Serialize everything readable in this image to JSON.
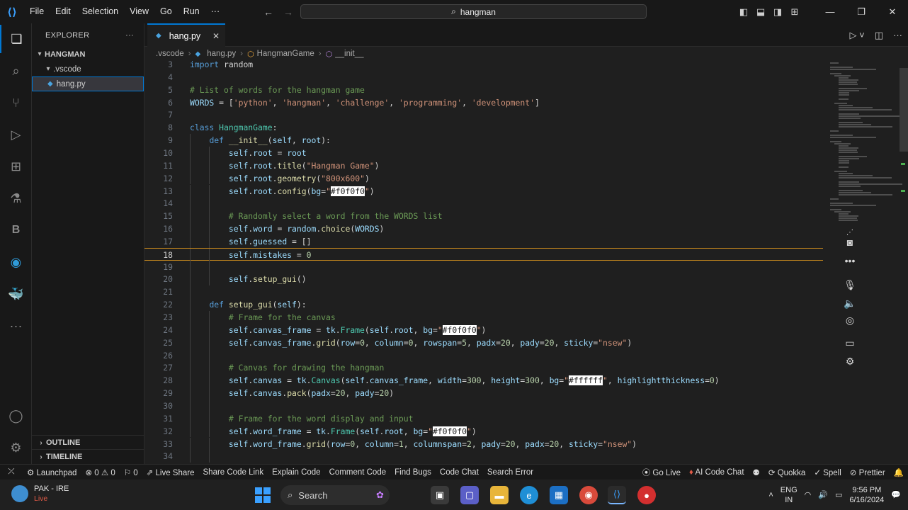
{
  "titlebar": {
    "menu": [
      "File",
      "Edit",
      "Selection",
      "View",
      "Go",
      "Run",
      "···"
    ],
    "search_text": "hangman"
  },
  "sidebar": {
    "title": "EXPLORER",
    "more": "···",
    "root": "HANGMAN",
    "folder": ".vscode",
    "file": "hang.py",
    "outline": "OUTLINE",
    "timeline": "TIMELINE"
  },
  "tab": {
    "label": "hang.py"
  },
  "breadcrumb": [
    ".vscode",
    "hang.py",
    "HangmanGame",
    "__init__"
  ],
  "code": {
    "active_line": 18,
    "lines": [
      {
        "n": 3,
        "indent": 0,
        "tokens": [
          [
            "kw",
            "import"
          ],
          [
            "plain",
            " random"
          ]
        ]
      },
      {
        "n": 4,
        "indent": 0,
        "tokens": []
      },
      {
        "n": 5,
        "indent": 0,
        "tokens": [
          [
            "cm",
            "# List of words for the hangman game"
          ]
        ]
      },
      {
        "n": 6,
        "indent": 0,
        "tokens": [
          [
            "sf",
            "WORDS"
          ],
          [
            "plain",
            " = ["
          ],
          [
            "str",
            "'python'"
          ],
          [
            "plain",
            ", "
          ],
          [
            "str",
            "'hangman'"
          ],
          [
            "plain",
            ", "
          ],
          [
            "str",
            "'challenge'"
          ],
          [
            "plain",
            ", "
          ],
          [
            "str",
            "'programming'"
          ],
          [
            "plain",
            ", "
          ],
          [
            "str",
            "'development'"
          ],
          [
            "plain",
            "]"
          ]
        ]
      },
      {
        "n": 7,
        "indent": 0,
        "tokens": []
      },
      {
        "n": 8,
        "indent": 0,
        "tokens": [
          [
            "kw",
            "class "
          ],
          [
            "cls",
            "HangmanGame"
          ],
          [
            "plain",
            ":"
          ]
        ]
      },
      {
        "n": 9,
        "indent": 1,
        "tokens": [
          [
            "kw",
            "def "
          ],
          [
            "fn",
            "__init__"
          ],
          [
            "plain",
            "("
          ],
          [
            "sf",
            "self"
          ],
          [
            "plain",
            ", "
          ],
          [
            "sf",
            "root"
          ],
          [
            "plain",
            "):"
          ]
        ]
      },
      {
        "n": 10,
        "indent": 2,
        "tokens": [
          [
            "sf",
            "self"
          ],
          [
            "plain",
            "."
          ],
          [
            "sf",
            "root"
          ],
          [
            "plain",
            " = "
          ],
          [
            "sf",
            "root"
          ]
        ]
      },
      {
        "n": 11,
        "indent": 2,
        "tokens": [
          [
            "sf",
            "self"
          ],
          [
            "plain",
            "."
          ],
          [
            "sf",
            "root"
          ],
          [
            "plain",
            "."
          ],
          [
            "fn",
            "title"
          ],
          [
            "plain",
            "("
          ],
          [
            "str",
            "\"Hangman Game\""
          ],
          [
            "plain",
            ")"
          ]
        ]
      },
      {
        "n": 12,
        "indent": 2,
        "tokens": [
          [
            "sf",
            "self"
          ],
          [
            "plain",
            "."
          ],
          [
            "sf",
            "root"
          ],
          [
            "plain",
            "."
          ],
          [
            "fn",
            "geometry"
          ],
          [
            "plain",
            "("
          ],
          [
            "str",
            "\"800x600\""
          ],
          [
            "plain",
            ")"
          ]
        ]
      },
      {
        "n": 13,
        "indent": 2,
        "tokens": [
          [
            "sf",
            "self"
          ],
          [
            "plain",
            "."
          ],
          [
            "sf",
            "root"
          ],
          [
            "plain",
            "."
          ],
          [
            "fn",
            "config"
          ],
          [
            "plain",
            "("
          ],
          [
            "sf",
            "bg"
          ],
          [
            "plain",
            "="
          ],
          [
            "str",
            "\""
          ],
          [
            "hl",
            "#f0f0f0"
          ],
          [
            "str",
            "\""
          ],
          [
            "plain",
            ")"
          ]
        ]
      },
      {
        "n": 14,
        "indent": 2,
        "tokens": []
      },
      {
        "n": 15,
        "indent": 2,
        "tokens": [
          [
            "cm",
            "# Randomly select a word from the WORDS list"
          ]
        ]
      },
      {
        "n": 16,
        "indent": 2,
        "tokens": [
          [
            "sf",
            "self"
          ],
          [
            "plain",
            "."
          ],
          [
            "sf",
            "word"
          ],
          [
            "plain",
            " = "
          ],
          [
            "sf",
            "random"
          ],
          [
            "plain",
            "."
          ],
          [
            "fn",
            "choice"
          ],
          [
            "plain",
            "("
          ],
          [
            "sf",
            "WORDS"
          ],
          [
            "plain",
            ")"
          ]
        ]
      },
      {
        "n": 17,
        "indent": 2,
        "tokens": [
          [
            "sf",
            "self"
          ],
          [
            "plain",
            "."
          ],
          [
            "sf",
            "guessed"
          ],
          [
            "plain",
            " = []"
          ]
        ]
      },
      {
        "n": 18,
        "indent": 2,
        "tokens": [
          [
            "sf",
            "self"
          ],
          [
            "plain",
            "."
          ],
          [
            "sf",
            "mistakes"
          ],
          [
            "plain",
            " = "
          ],
          [
            "num",
            "0"
          ]
        ]
      },
      {
        "n": 19,
        "indent": 2,
        "tokens": []
      },
      {
        "n": 20,
        "indent": 2,
        "tokens": [
          [
            "sf",
            "self"
          ],
          [
            "plain",
            "."
          ],
          [
            "fn",
            "setup_gui"
          ],
          [
            "plain",
            "()"
          ]
        ]
      },
      {
        "n": 21,
        "indent": 1,
        "tokens": []
      },
      {
        "n": 22,
        "indent": 1,
        "tokens": [
          [
            "kw",
            "def "
          ],
          [
            "fn",
            "setup_gui"
          ],
          [
            "plain",
            "("
          ],
          [
            "sf",
            "self"
          ],
          [
            "plain",
            "):"
          ]
        ]
      },
      {
        "n": 23,
        "indent": 2,
        "tokens": [
          [
            "cm",
            "# Frame for the canvas"
          ]
        ]
      },
      {
        "n": 24,
        "indent": 2,
        "tokens": [
          [
            "sf",
            "self"
          ],
          [
            "plain",
            "."
          ],
          [
            "sf",
            "canvas_frame"
          ],
          [
            "plain",
            " = "
          ],
          [
            "sf",
            "tk"
          ],
          [
            "plain",
            "."
          ],
          [
            "cls",
            "Frame"
          ],
          [
            "plain",
            "("
          ],
          [
            "sf",
            "self"
          ],
          [
            "plain",
            "."
          ],
          [
            "sf",
            "root"
          ],
          [
            "plain",
            ", "
          ],
          [
            "sf",
            "bg"
          ],
          [
            "plain",
            "="
          ],
          [
            "str",
            "\""
          ],
          [
            "hl",
            "#f0f0f0"
          ],
          [
            "str",
            "\""
          ],
          [
            "plain",
            ")"
          ]
        ]
      },
      {
        "n": 25,
        "indent": 2,
        "tokens": [
          [
            "sf",
            "self"
          ],
          [
            "plain",
            "."
          ],
          [
            "sf",
            "canvas_frame"
          ],
          [
            "plain",
            "."
          ],
          [
            "fn",
            "grid"
          ],
          [
            "plain",
            "("
          ],
          [
            "sf",
            "row"
          ],
          [
            "plain",
            "="
          ],
          [
            "num",
            "0"
          ],
          [
            "plain",
            ", "
          ],
          [
            "sf",
            "column"
          ],
          [
            "plain",
            "="
          ],
          [
            "num",
            "0"
          ],
          [
            "plain",
            ", "
          ],
          [
            "sf",
            "rowspan"
          ],
          [
            "plain",
            "="
          ],
          [
            "num",
            "5"
          ],
          [
            "plain",
            ", "
          ],
          [
            "sf",
            "padx"
          ],
          [
            "plain",
            "="
          ],
          [
            "num",
            "20"
          ],
          [
            "plain",
            ", "
          ],
          [
            "sf",
            "pady"
          ],
          [
            "plain",
            "="
          ],
          [
            "num",
            "20"
          ],
          [
            "plain",
            ", "
          ],
          [
            "sf",
            "sticky"
          ],
          [
            "plain",
            "="
          ],
          [
            "str",
            "\"nsew\""
          ],
          [
            "plain",
            ")"
          ]
        ]
      },
      {
        "n": 26,
        "indent": 2,
        "tokens": []
      },
      {
        "n": 27,
        "indent": 2,
        "tokens": [
          [
            "cm",
            "# Canvas for drawing the hangman"
          ]
        ]
      },
      {
        "n": 28,
        "indent": 2,
        "tokens": [
          [
            "sf",
            "self"
          ],
          [
            "plain",
            "."
          ],
          [
            "sf",
            "canvas"
          ],
          [
            "plain",
            " = "
          ],
          [
            "sf",
            "tk"
          ],
          [
            "plain",
            "."
          ],
          [
            "cls",
            "Canvas"
          ],
          [
            "plain",
            "("
          ],
          [
            "sf",
            "self"
          ],
          [
            "plain",
            "."
          ],
          [
            "sf",
            "canvas_frame"
          ],
          [
            "plain",
            ", "
          ],
          [
            "sf",
            "width"
          ],
          [
            "plain",
            "="
          ],
          [
            "num",
            "300"
          ],
          [
            "plain",
            ", "
          ],
          [
            "sf",
            "height"
          ],
          [
            "plain",
            "="
          ],
          [
            "num",
            "300"
          ],
          [
            "plain",
            ", "
          ],
          [
            "sf",
            "bg"
          ],
          [
            "plain",
            "="
          ],
          [
            "str",
            "\""
          ],
          [
            "hl",
            "#ffffff"
          ],
          [
            "str",
            "\""
          ],
          [
            "plain",
            ", "
          ],
          [
            "sf",
            "highlightthickness"
          ],
          [
            "plain",
            "="
          ],
          [
            "num",
            "0"
          ],
          [
            "plain",
            ")"
          ]
        ]
      },
      {
        "n": 29,
        "indent": 2,
        "tokens": [
          [
            "sf",
            "self"
          ],
          [
            "plain",
            "."
          ],
          [
            "sf",
            "canvas"
          ],
          [
            "plain",
            "."
          ],
          [
            "fn",
            "pack"
          ],
          [
            "plain",
            "("
          ],
          [
            "sf",
            "padx"
          ],
          [
            "plain",
            "="
          ],
          [
            "num",
            "20"
          ],
          [
            "plain",
            ", "
          ],
          [
            "sf",
            "pady"
          ],
          [
            "plain",
            "="
          ],
          [
            "num",
            "20"
          ],
          [
            "plain",
            ")"
          ]
        ]
      },
      {
        "n": 30,
        "indent": 2,
        "tokens": []
      },
      {
        "n": 31,
        "indent": 2,
        "tokens": [
          [
            "cm",
            "# Frame for the word display and input"
          ]
        ]
      },
      {
        "n": 32,
        "indent": 2,
        "tokens": [
          [
            "sf",
            "self"
          ],
          [
            "plain",
            "."
          ],
          [
            "sf",
            "word_frame"
          ],
          [
            "plain",
            " = "
          ],
          [
            "sf",
            "tk"
          ],
          [
            "plain",
            "."
          ],
          [
            "cls",
            "Frame"
          ],
          [
            "plain",
            "("
          ],
          [
            "sf",
            "self"
          ],
          [
            "plain",
            "."
          ],
          [
            "sf",
            "root"
          ],
          [
            "plain",
            ", "
          ],
          [
            "sf",
            "bg"
          ],
          [
            "plain",
            "="
          ],
          [
            "str",
            "\""
          ],
          [
            "hl",
            "#f0f0f0"
          ],
          [
            "str",
            "\""
          ],
          [
            "plain",
            ")"
          ]
        ]
      },
      {
        "n": 33,
        "indent": 2,
        "tokens": [
          [
            "sf",
            "self"
          ],
          [
            "plain",
            "."
          ],
          [
            "sf",
            "word_frame"
          ],
          [
            "plain",
            "."
          ],
          [
            "fn",
            "grid"
          ],
          [
            "plain",
            "("
          ],
          [
            "sf",
            "row"
          ],
          [
            "plain",
            "="
          ],
          [
            "num",
            "0"
          ],
          [
            "plain",
            ", "
          ],
          [
            "sf",
            "column"
          ],
          [
            "plain",
            "="
          ],
          [
            "num",
            "1"
          ],
          [
            "plain",
            ", "
          ],
          [
            "sf",
            "columnspan"
          ],
          [
            "plain",
            "="
          ],
          [
            "num",
            "2"
          ],
          [
            "plain",
            ", "
          ],
          [
            "sf",
            "pady"
          ],
          [
            "plain",
            "="
          ],
          [
            "num",
            "20"
          ],
          [
            "plain",
            ", "
          ],
          [
            "sf",
            "padx"
          ],
          [
            "plain",
            "="
          ],
          [
            "num",
            "20"
          ],
          [
            "plain",
            ", "
          ],
          [
            "sf",
            "sticky"
          ],
          [
            "plain",
            "="
          ],
          [
            "str",
            "\"nsew\""
          ],
          [
            "plain",
            ")"
          ]
        ]
      },
      {
        "n": 34,
        "indent": 2,
        "tokens": []
      }
    ]
  },
  "statusbar": {
    "launchpad": "Launchpad",
    "problems": "⊗ 0 ⚠ 0",
    "ports": "⚐ 0",
    "live_share": "Live Share",
    "share_code_link": "Share Code Link",
    "explain_code": "Explain Code",
    "comment_code": "Comment Code",
    "find_bugs": "Find Bugs",
    "code_chat": "Code Chat",
    "search_error": "Search Error",
    "go_live": "Go Live",
    "ai_code_chat": "AI Code Chat",
    "quokka": "Quokka",
    "spell": "Spell",
    "prettier": "Prettier"
  },
  "taskbar": {
    "weather_title": "PAK - IRE",
    "weather_sub": "Live",
    "search": "Search",
    "lang_top": "ENG",
    "lang_bottom": "IN",
    "time": "9:56 PM",
    "date": "6/16/2024"
  },
  "colors": {
    "accent": "#0078d4",
    "current_line_border": "#c98a1e",
    "editor_bg": "#1f1f1f"
  }
}
